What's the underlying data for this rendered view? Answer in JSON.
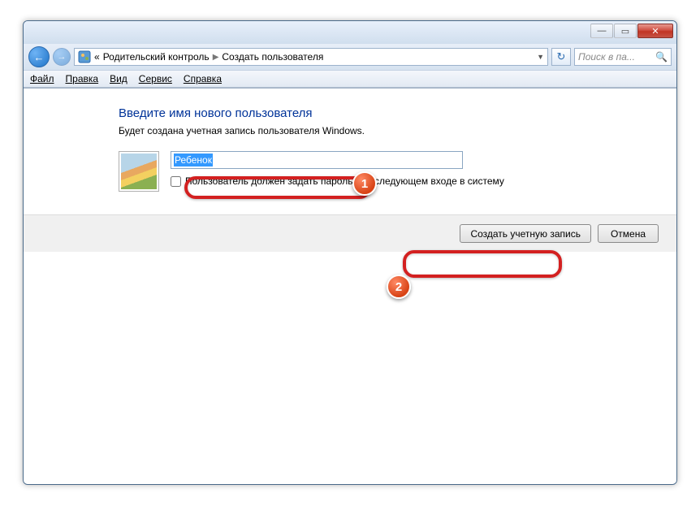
{
  "titlebar": {
    "minimize": "—",
    "maximize": "▭",
    "close": "✕"
  },
  "nav": {
    "back": "←",
    "forward": "→",
    "crumb_prefix": "«",
    "crumb1": "Родительский контроль",
    "crumb2": "Создать пользователя",
    "refresh": "↻"
  },
  "search": {
    "placeholder": "Поиск в па...",
    "icon": "🔍"
  },
  "menu": {
    "file": "Файл",
    "edit": "Правка",
    "view": "Вид",
    "tools": "Сервис",
    "help": "Справка"
  },
  "content": {
    "heading": "Введите имя нового пользователя",
    "subtext": "Будет создана учетная запись пользователя Windows.",
    "input_value": "Ребенок",
    "checkbox_label": "Пользователь должен задать пароль при следующем входе в систему"
  },
  "buttons": {
    "create": "Создать учетную запись",
    "cancel": "Отмена"
  },
  "annotations": {
    "badge1": "1",
    "badge2": "2"
  }
}
